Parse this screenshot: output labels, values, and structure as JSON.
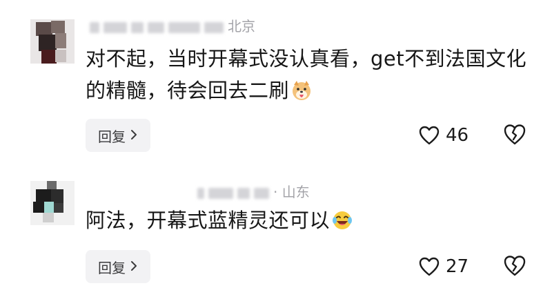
{
  "comments": [
    {
      "location": "北京",
      "text": "对不起，当时开幕式没认真看，get不到法国文化的精髓，待会回去二刷",
      "emoji_icon": "dog-tongue-emoji",
      "reply_label": "回复",
      "like_count": "46"
    },
    {
      "location": "· 山东",
      "text": "阿法，开幕式蓝精灵还可以",
      "emoji_icon": "laughing-tears-emoji",
      "reply_label": "回复",
      "like_count": "27"
    }
  ],
  "colors": {
    "meta_gray": "#a3a3a8",
    "reply_bg": "#f2f2f4",
    "text": "#161616"
  },
  "icons": [
    "heart-outline-icon",
    "broken-heart-icon",
    "chevron-right-icon"
  ]
}
